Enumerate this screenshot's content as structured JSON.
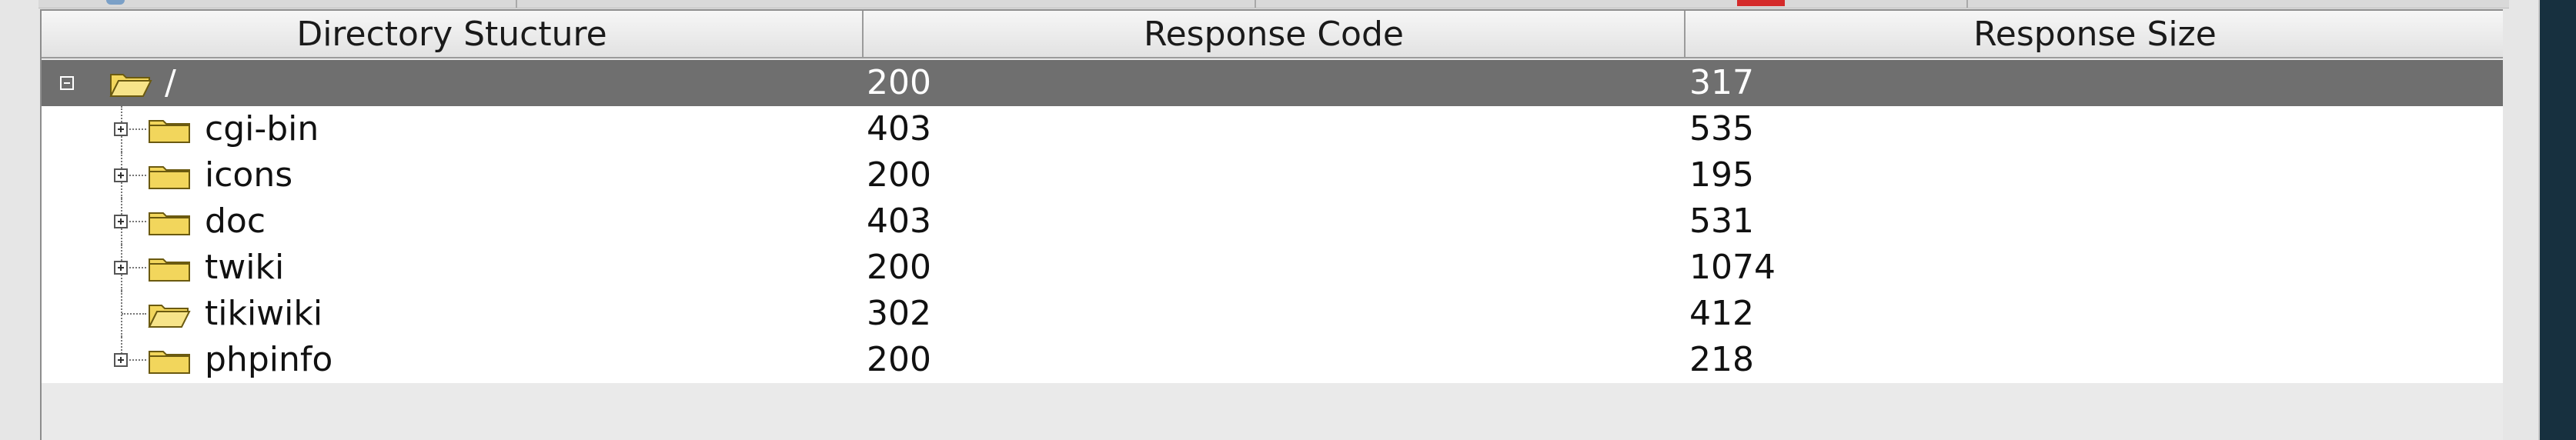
{
  "table": {
    "columns": [
      {
        "label": "Directory Stucture"
      },
      {
        "label": "Response Code"
      },
      {
        "label": "Response Size"
      }
    ],
    "rows": [
      {
        "name": "/",
        "code": "200",
        "size": "317",
        "state": "expanded",
        "selected": true
      },
      {
        "name": "cgi-bin",
        "code": "403",
        "size": "535",
        "state": "collapsed"
      },
      {
        "name": "icons",
        "code": "200",
        "size": "195",
        "state": "collapsed"
      },
      {
        "name": "doc",
        "code": "403",
        "size": "531",
        "state": "collapsed"
      },
      {
        "name": "twiki",
        "code": "200",
        "size": "1074",
        "state": "collapsed"
      },
      {
        "name": "tikiwiki",
        "code": "302",
        "size": "412",
        "state": "leaf-open"
      },
      {
        "name": "phpinfo",
        "code": "200",
        "size": "218",
        "state": "collapsed"
      }
    ]
  },
  "colors": {
    "selected_row": "#6f6f6f",
    "folder_fill": "#f2d65c",
    "folder_stroke": "#6b5a10"
  }
}
